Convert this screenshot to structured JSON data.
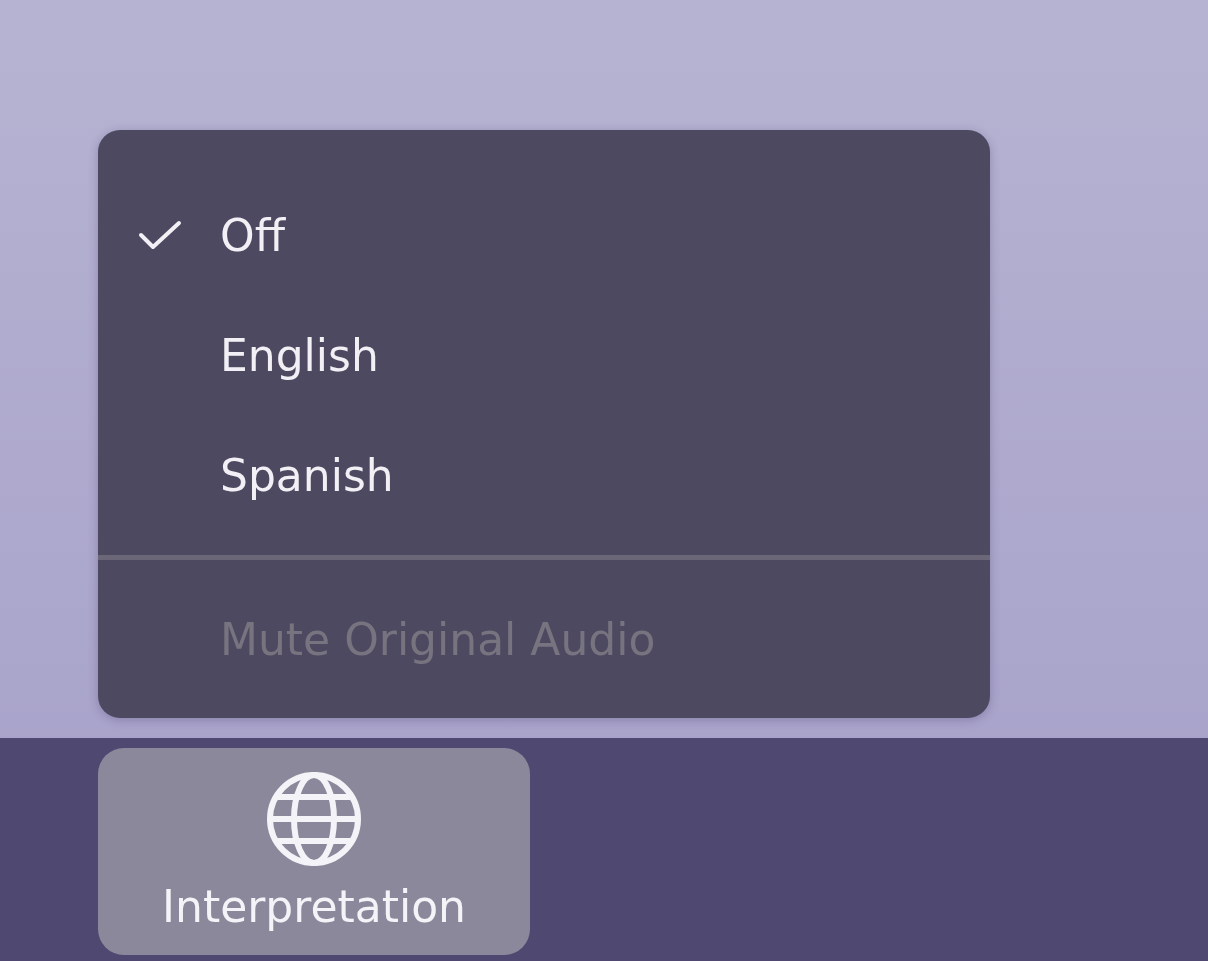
{
  "menu": {
    "items": [
      {
        "label": "Off",
        "selected": true
      },
      {
        "label": "English",
        "selected": false
      },
      {
        "label": "Spanish",
        "selected": false
      }
    ],
    "mute_option": {
      "label": "Mute Original Audio",
      "disabled": true
    }
  },
  "toolbar": {
    "buttons": [
      {
        "label": "Interpretation",
        "highlighted": true
      }
    ]
  }
}
